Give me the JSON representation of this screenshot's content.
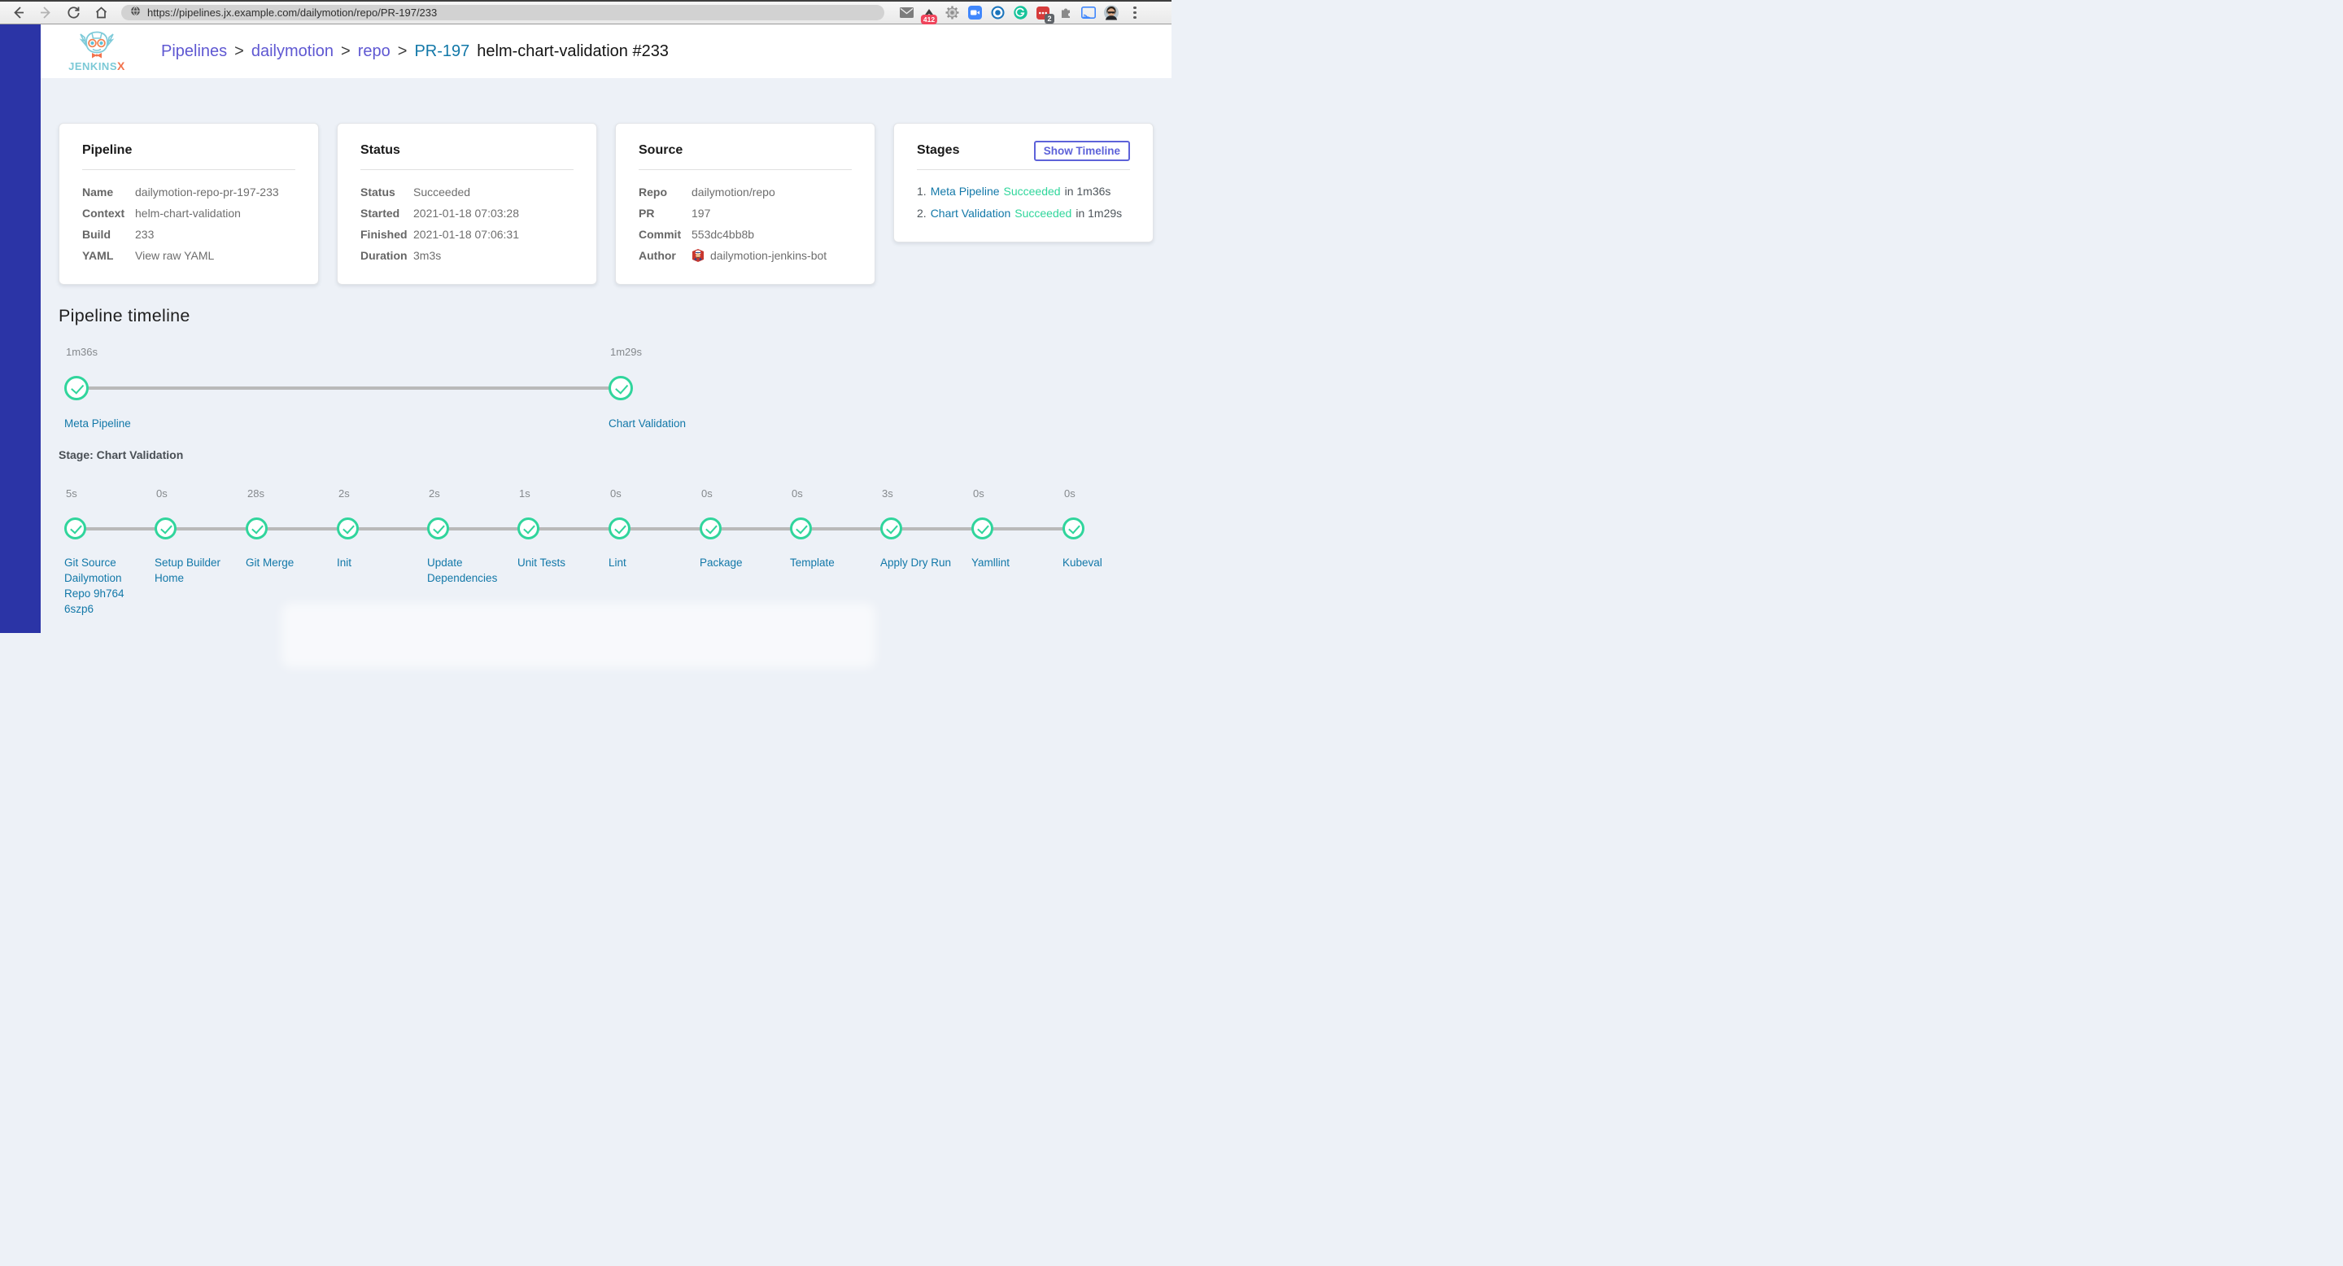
{
  "browser": {
    "url": "https://pipelines.jx.example.com/dailymotion/repo/PR-197/233",
    "nav_icons": [
      "back-icon",
      "forward-icon",
      "reload-icon",
      "home-icon"
    ],
    "url_icon": "globe-icon",
    "extension_icons": [
      "mail-icon",
      "upload-arrow-icon",
      "gear-icon",
      "video-call-icon",
      "ring-icon",
      "grammarly-icon",
      "password-dots-icon",
      "puzzle-icon",
      "cast-icon"
    ],
    "upload_badge": "412",
    "password_badge": "2"
  },
  "header": {
    "logo_primary": "JENKINS",
    "logo_accent": "X",
    "separator": ">",
    "breadcrumb": [
      {
        "label": "Pipelines"
      },
      {
        "label": "dailymotion"
      },
      {
        "label": "repo"
      },
      {
        "label": "PR-197"
      },
      {
        "label": "helm-chart-validation #233"
      }
    ]
  },
  "cards": {
    "pipeline": {
      "title": "Pipeline",
      "rows": [
        {
          "label": "Name",
          "value": "dailymotion-repo-pr-197-233"
        },
        {
          "label": "Context",
          "value": "helm-chart-validation"
        },
        {
          "label": "Build",
          "value": "233"
        },
        {
          "label": "YAML",
          "value": "View raw YAML"
        }
      ]
    },
    "status": {
      "title": "Status",
      "rows": [
        {
          "label": "Status",
          "value": "Succeeded"
        },
        {
          "label": "Started",
          "value": "2021-01-18 07:03:28"
        },
        {
          "label": "Finished",
          "value": "2021-01-18 07:06:31"
        },
        {
          "label": "Duration",
          "value": "3m3s"
        }
      ]
    },
    "source": {
      "title": "Source",
      "rows": [
        {
          "label": "Repo",
          "value": "dailymotion/repo"
        },
        {
          "label": "PR",
          "value": "197"
        },
        {
          "label": "Commit",
          "value": "553dc4bb8b"
        },
        {
          "label": "Author",
          "value": "dailymotion-jenkins-bot"
        }
      ]
    },
    "stages": {
      "title": "Stages",
      "button_label": "Show Timeline",
      "items": [
        {
          "num": "1.",
          "name": "Meta Pipeline",
          "status": "Succeeded",
          "suffix": "in 1m36s"
        },
        {
          "num": "2.",
          "name": "Chart Validation",
          "status": "Succeeded",
          "suffix": "in 1m29s"
        }
      ]
    }
  },
  "timeline": {
    "heading": "Pipeline timeline",
    "stage_heading": "Stage: Chart Validation",
    "stages": [
      {
        "duration": "1m36s",
        "name": "Meta Pipeline"
      },
      {
        "duration": "1m29s",
        "name": "Chart Validation"
      }
    ],
    "steps": [
      {
        "duration": "5s",
        "name": "Git Source Dailymotion Repo 9h764 6szp6"
      },
      {
        "duration": "0s",
        "name": "Setup Builder Home"
      },
      {
        "duration": "28s",
        "name": "Git Merge"
      },
      {
        "duration": "2s",
        "name": "Init"
      },
      {
        "duration": "2s",
        "name": "Update Dependencies"
      },
      {
        "duration": "1s",
        "name": "Unit Tests"
      },
      {
        "duration": "0s",
        "name": "Lint"
      },
      {
        "duration": "0s",
        "name": "Package"
      },
      {
        "duration": "0s",
        "name": "Template"
      },
      {
        "duration": "3s",
        "name": "Apply Dry Run"
      },
      {
        "duration": "0s",
        "name": "Yamllint"
      },
      {
        "duration": "0s",
        "name": "Kubeval"
      }
    ]
  },
  "colors": {
    "sidebar": "#2b34a6",
    "success_green": "#2fd69b",
    "teal_link": "#1278a8",
    "purple_link": "#5f58d2",
    "accent_button": "#5d62d9",
    "background": "#edf1f7"
  }
}
